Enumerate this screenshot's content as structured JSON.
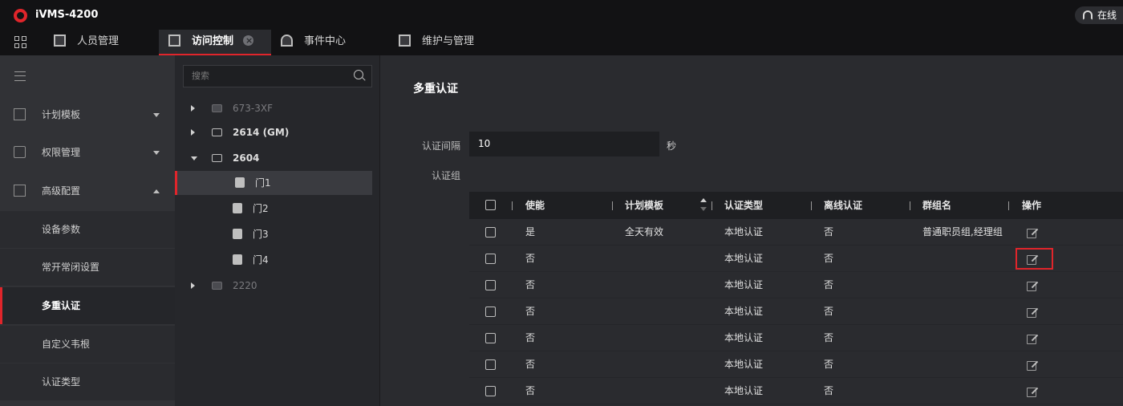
{
  "app": {
    "title": "iVMS-4200",
    "online_label": "在线"
  },
  "tabs": [
    {
      "label": "人员管理"
    },
    {
      "label": "访问控制"
    },
    {
      "label": "事件中心"
    },
    {
      "label": "维护与管理"
    }
  ],
  "nav": {
    "items": [
      {
        "label": "计划模板",
        "expanded": false
      },
      {
        "label": "权限管理",
        "expanded": false
      },
      {
        "label": "高级配置",
        "expanded": true
      }
    ],
    "sub_items": [
      {
        "label": "设备参数"
      },
      {
        "label": "常开常闭设置"
      },
      {
        "label": "多重认证",
        "active": true
      },
      {
        "label": "自定义韦根"
      },
      {
        "label": "认证类型"
      }
    ]
  },
  "tree": {
    "search_placeholder": "搜索",
    "devices": [
      {
        "label": "673-3XF",
        "online": false
      },
      {
        "label": "2614 (GM)",
        "online": true
      },
      {
        "label": "2604",
        "online": true,
        "expanded": true
      },
      {
        "label": "2220",
        "online": false
      }
    ],
    "doors": [
      {
        "label": "门1",
        "selected": true
      },
      {
        "label": "门2"
      },
      {
        "label": "门3"
      },
      {
        "label": "门4"
      }
    ]
  },
  "main": {
    "title": "多重认证",
    "interval_label": "认证间隔",
    "interval_value": "10",
    "interval_unit": "秒",
    "group_label": "认证组"
  },
  "table": {
    "columns": [
      "使能",
      "计划模板",
      "认证类型",
      "离线认证",
      "群组名",
      "操作"
    ],
    "rows": [
      {
        "enabled": "是",
        "template": "全天有效",
        "type": "本地认证",
        "offline": "否",
        "group": "普通职员组,经理组"
      },
      {
        "enabled": "否",
        "template": "",
        "type": "本地认证",
        "offline": "否",
        "group": "",
        "highlighted": true
      },
      {
        "enabled": "否",
        "template": "",
        "type": "本地认证",
        "offline": "否",
        "group": ""
      },
      {
        "enabled": "否",
        "template": "",
        "type": "本地认证",
        "offline": "否",
        "group": ""
      },
      {
        "enabled": "否",
        "template": "",
        "type": "本地认证",
        "offline": "否",
        "group": ""
      },
      {
        "enabled": "否",
        "template": "",
        "type": "本地认证",
        "offline": "否",
        "group": ""
      },
      {
        "enabled": "否",
        "template": "",
        "type": "本地认证",
        "offline": "否",
        "group": ""
      }
    ]
  },
  "colors": {
    "accent": "#e0252b",
    "background": "#2a2b2f",
    "topbar": "#121214"
  }
}
